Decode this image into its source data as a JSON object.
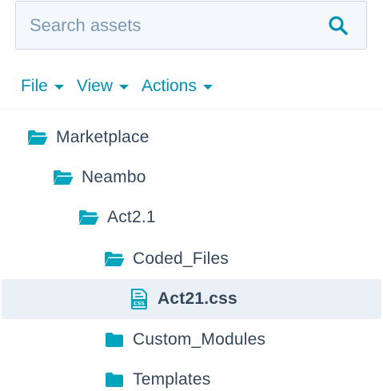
{
  "search": {
    "placeholder": "Search assets",
    "icon": "search-icon"
  },
  "menu": {
    "items": [
      {
        "label": "File"
      },
      {
        "label": "View"
      },
      {
        "label": "Actions"
      }
    ]
  },
  "tree": {
    "nodes": [
      {
        "label": "Marketplace",
        "icon": "folder-open-icon",
        "depth": 0
      },
      {
        "label": "Neambo",
        "icon": "folder-open-icon",
        "depth": 1
      },
      {
        "label": "Act2.1",
        "icon": "folder-open-icon",
        "depth": 2
      },
      {
        "label": "Coded_Files",
        "icon": "folder-open-icon",
        "depth": 3
      },
      {
        "label": "Act21.css",
        "icon": "css-file-icon",
        "depth": 4,
        "selected": true
      },
      {
        "label": "Custom_Modules",
        "icon": "folder-icon",
        "depth": 3
      },
      {
        "label": "Templates",
        "icon": "folder-icon",
        "depth": 3
      }
    ]
  },
  "colors": {
    "accent": "#0091ae",
    "folder": "#00a4bd",
    "text": "#33475b",
    "selected_bg": "#eaf0f6"
  }
}
